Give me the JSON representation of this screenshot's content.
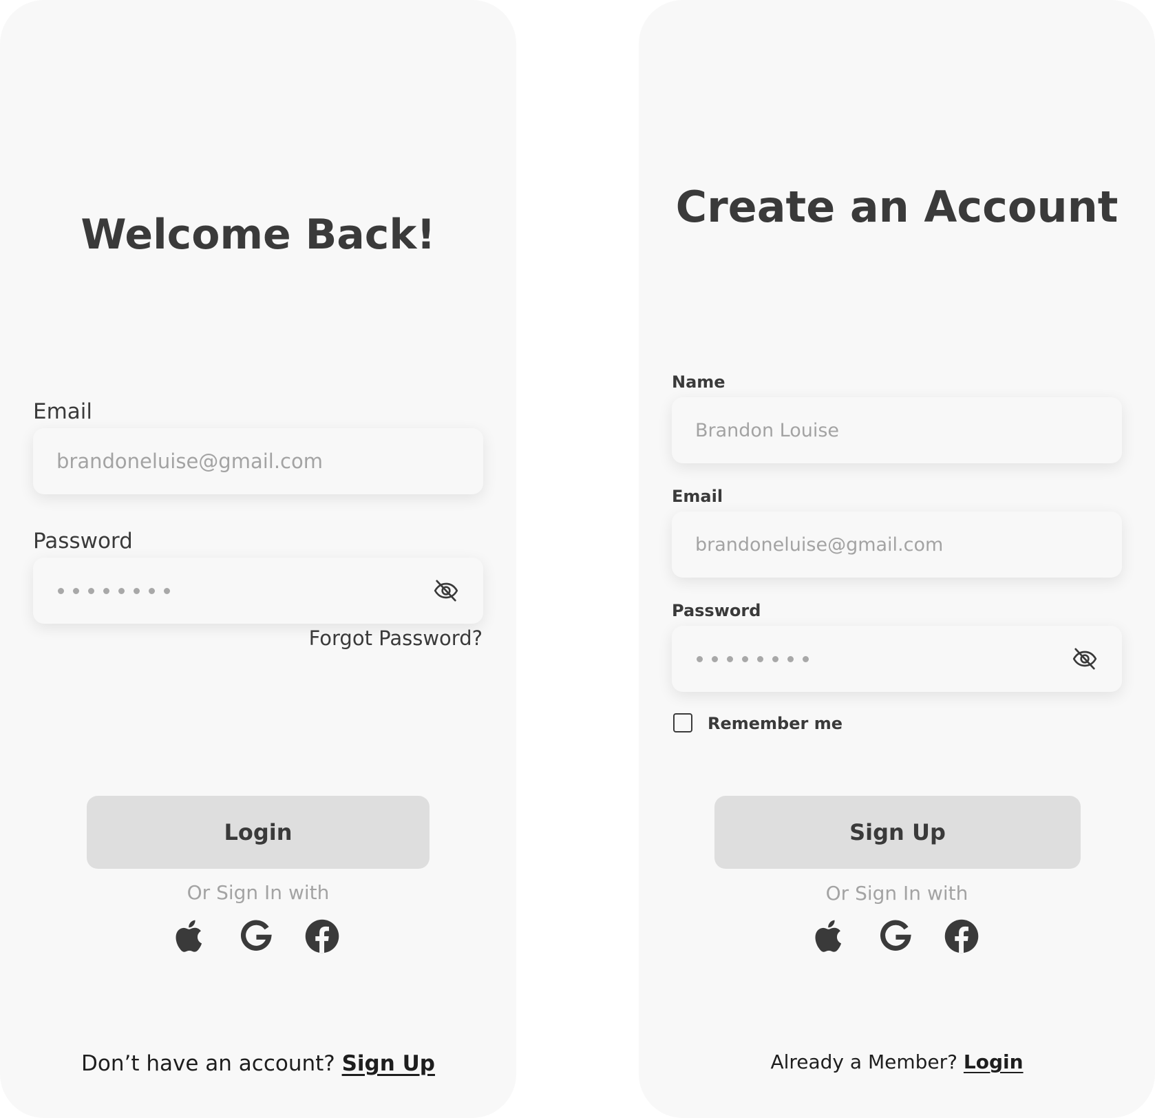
{
  "login": {
    "title": "Welcome Back!",
    "email_label": "Email",
    "email_placeholder": "brandoneluise@gmail.com",
    "password_label": "Password",
    "forgot_password": "Forgot Password?",
    "login_button": "Login",
    "or_sign_in": "Or Sign In with",
    "social_icons": [
      "apple-icon",
      "google-icon",
      "facebook-icon"
    ],
    "footer_text": "Don’t have an account?",
    "footer_link": "Sign Up"
  },
  "signup": {
    "title": "Create an Account",
    "name_label": "Name",
    "name_placeholder": "Brandon Louise",
    "email_label": "Email",
    "email_placeholder": "brandoneluise@gmail.com",
    "password_label": "Password",
    "remember_me": "Remember me",
    "signup_button": "Sign Up",
    "or_sign_in": "Or Sign In with",
    "social_icons": [
      "apple-icon",
      "google-icon",
      "facebook-icon"
    ],
    "footer_text": "Already a Member?",
    "footer_link": "Login"
  },
  "colors": {
    "screen_background": "#f8f8f8",
    "text_dark": "#3a3a3a",
    "placeholder": "#a3a3a3",
    "button_background": "#dedede"
  }
}
